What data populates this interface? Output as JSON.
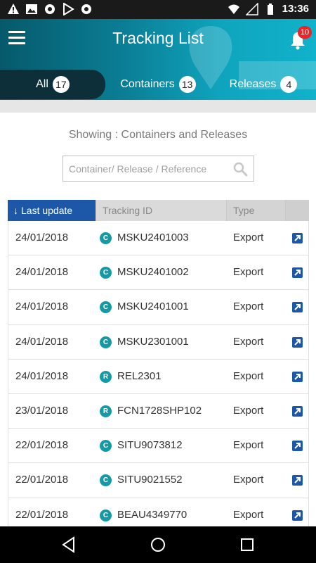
{
  "status_bar": {
    "time": "13:36",
    "left_icons": [
      "warning-icon",
      "image-icon",
      "settings-icon",
      "play-store-icon",
      "settings-icon"
    ],
    "right_icons": [
      "wifi-icon",
      "signal-icon",
      "battery-icon"
    ]
  },
  "header": {
    "title": "Tracking List",
    "notification_count": "10",
    "tabs": [
      {
        "label": "All",
        "count": "17",
        "active": true
      },
      {
        "label": "Containers",
        "count": "13",
        "active": false
      },
      {
        "label": "Releases",
        "count": "4",
        "active": false
      }
    ]
  },
  "filter": {
    "showing_text": "Showing : Containers and Releases",
    "search_placeholder": "Container/ Release / Reference",
    "search_value": ""
  },
  "table": {
    "columns": {
      "last_update": "Last update",
      "tracking_id": "Tracking ID",
      "type": "Type"
    },
    "rows": [
      {
        "date": "24/01/2018",
        "kind": "C",
        "id": "MSKU2401003",
        "type": "Export"
      },
      {
        "date": "24/01/2018",
        "kind": "C",
        "id": "MSKU2401002",
        "type": "Export"
      },
      {
        "date": "24/01/2018",
        "kind": "C",
        "id": "MSKU2401001",
        "type": "Export"
      },
      {
        "date": "24/01/2018",
        "kind": "C",
        "id": "MSKU2301001",
        "type": "Export"
      },
      {
        "date": "24/01/2018",
        "kind": "R",
        "id": "REL2301",
        "type": "Export"
      },
      {
        "date": "23/01/2018",
        "kind": "R",
        "id": "FCN1728SHP102",
        "type": "Export"
      },
      {
        "date": "22/01/2018",
        "kind": "C",
        "id": "SITU9073812",
        "type": "Export"
      },
      {
        "date": "22/01/2018",
        "kind": "C",
        "id": "SITU9021552",
        "type": "Export"
      },
      {
        "date": "22/01/2018",
        "kind": "C",
        "id": "BEAU4349770",
        "type": "Export"
      }
    ]
  },
  "colors": {
    "header_start": "#06596b",
    "header_end": "#11b2cb",
    "active_tab": "#0d2f3a",
    "sort_header": "#1d57a8",
    "kind_badge": "#149aa6",
    "notification_badge": "#e8262a"
  },
  "nav_bar": [
    "back-icon",
    "home-icon",
    "recents-icon"
  ]
}
